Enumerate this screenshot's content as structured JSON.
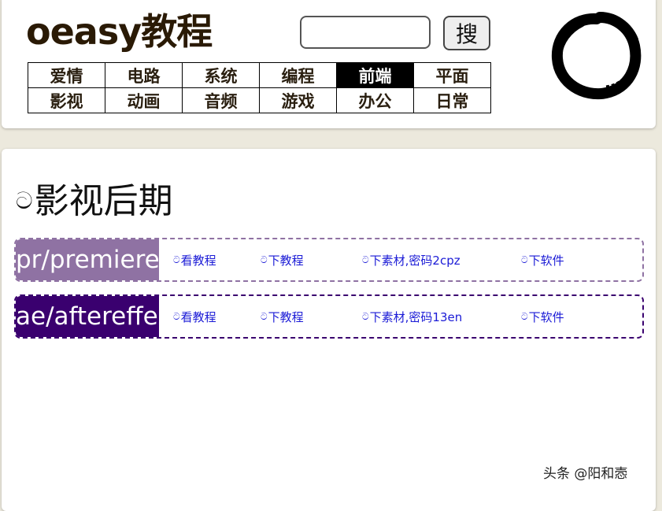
{
  "header": {
    "site_title": "oeasy教程",
    "search": {
      "value": "",
      "placeholder": ""
    },
    "search_button_label": "搜",
    "nav_items": [
      "爱情",
      "电路",
      "系统",
      "编程",
      "前端",
      "平面",
      "影视",
      "动画",
      "音频",
      "游戏",
      "办公",
      "日常"
    ],
    "active_nav": "前端",
    "logo_icon": "enso-circle-icon"
  },
  "section": {
    "title_icon": "ට",
    "title": "影视后期"
  },
  "courses": [
    {
      "name": "pr/premiere",
      "accent_color": "#8f72a3",
      "links": [
        {
          "icon": "ට",
          "label": "看教程"
        },
        {
          "icon": "ට",
          "label": "下教程"
        },
        {
          "icon": "ට",
          "label": "下素材,密码2cpz"
        },
        {
          "icon": "ට",
          "label": "下软件"
        }
      ]
    },
    {
      "name": "ae/aftereffe",
      "accent_color": "#3a006f",
      "links": [
        {
          "icon": "ට",
          "label": "看教程"
        },
        {
          "icon": "ට",
          "label": "下教程"
        },
        {
          "icon": "ට",
          "label": "下素材,密码13en"
        },
        {
          "icon": "ට",
          "label": "下软件"
        }
      ]
    }
  ],
  "watermark": "头条 @阳和悫"
}
